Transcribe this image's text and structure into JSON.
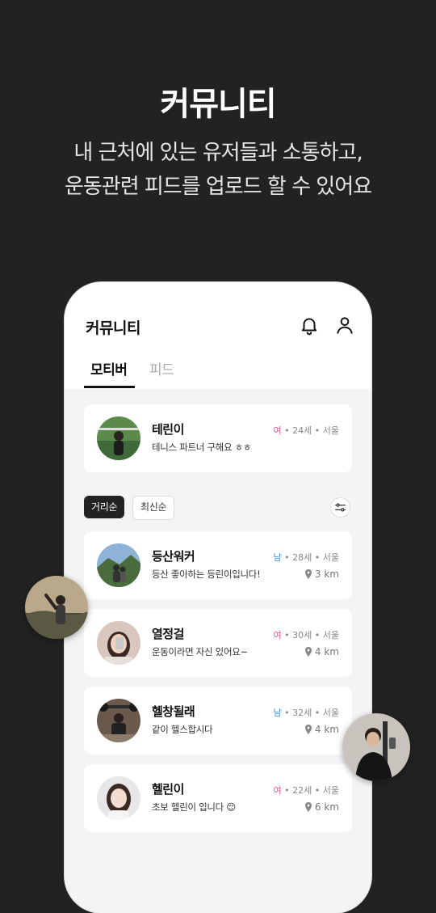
{
  "hero": {
    "title": "커뮤니티",
    "subtitle_line1": "내 근처에 있는 유저들과 소통하고,",
    "subtitle_line2": "운동관련 피드를 업로드 할 수 있어요"
  },
  "app": {
    "title": "커뮤니티",
    "icons": {
      "notifications": "bell-icon",
      "profile": "person-icon"
    },
    "tabs": [
      {
        "label": "모티버",
        "active": true
      },
      {
        "label": "피드",
        "active": false
      }
    ]
  },
  "my_card": {
    "nickname": "테린이",
    "bio": "테니스 파트너 구해요 ㅎㅎ",
    "gender": "여",
    "age": "24세",
    "location": "서울",
    "separator": "•"
  },
  "sort": {
    "options": [
      {
        "label": "거리순",
        "active": true
      },
      {
        "label": "최신순",
        "active": false
      }
    ],
    "filter_icon": "sliders-icon"
  },
  "users": [
    {
      "nickname": "등산워커",
      "bio": "등산 좋아하는 등린이입니다!",
      "gender": "남",
      "age": "28세",
      "location": "서울",
      "distance": "3 km"
    },
    {
      "nickname": "열정걸",
      "bio": "운동이라면 자신 있어요~",
      "gender": "여",
      "age": "30세",
      "location": "서울",
      "distance": "4 km"
    },
    {
      "nickname": "헬창될래",
      "bio": "같이 헬스합시다",
      "gender": "남",
      "age": "32세",
      "location": "서울",
      "distance": "4 km"
    },
    {
      "nickname": "헬린이",
      "bio": "초보 헬린이 입니다 😌",
      "gender": "여",
      "age": "22세",
      "location": "서울",
      "distance": "6 km"
    }
  ],
  "colors": {
    "background": "#222222",
    "female": "#ec4f8c",
    "male": "#3a8fd8",
    "card": "#ffffff",
    "screen": "#f4f4f6"
  }
}
